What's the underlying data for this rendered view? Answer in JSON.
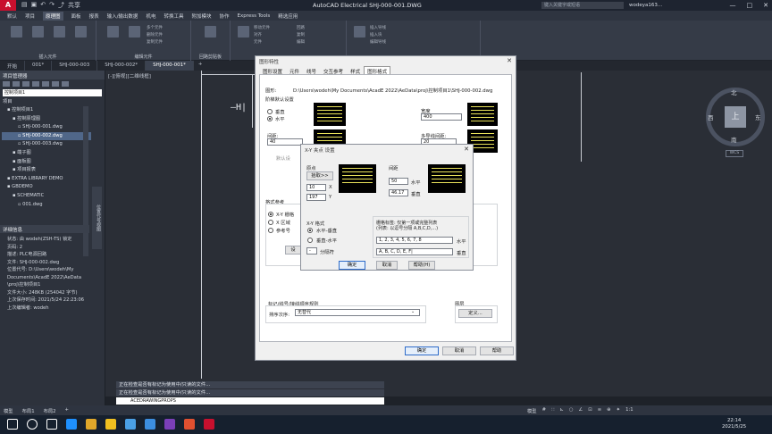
{
  "app": {
    "logo": "A",
    "title": "AutoCAD Electrical    SHJ-000-001.DWG",
    "share": "共享",
    "search_placeholder": "键入关键字或短语",
    "user": "wodeya163...",
    "window_buttons": [
      "—",
      "□",
      "✕"
    ]
  },
  "menu_tabs": [
    "默认",
    "项目",
    "原理图",
    "面板",
    "报表",
    "输入/输出数据",
    "机电",
    "转换工具",
    "附加模块",
    "协作",
    "Express Tools",
    "精选应用"
  ],
  "menu_active_index": 2,
  "ribbon": {
    "groups": [
      "插入元件",
      "编辑元件",
      "回路剪贴板"
    ],
    "small_items": [
      "多个元件",
      "删除元件",
      "复制元件",
      "移动元件",
      "对齐",
      "元件",
      "回路",
      "复制",
      "编辑",
      "插入导线",
      "插入块",
      "编辑导线"
    ]
  },
  "doc_tabs": [
    "开始",
    "001*",
    "SHJ-000-003",
    "SHJ-000-002*",
    "SHJ-000-001*"
  ],
  "doc_tab_active_index": 4,
  "project_manager": {
    "header": "项目管理器",
    "selector": "控制项目1",
    "section": "项目",
    "tree": [
      {
        "label": "控制项目1",
        "level": 1
      },
      {
        "label": "控制原理图",
        "level": 2
      },
      {
        "label": "SHJ-000-001.dwg",
        "level": 3
      },
      {
        "label": "SHJ-000-002.dwg",
        "level": 3
      },
      {
        "label": "SHJ-000-003.dwg",
        "level": 3
      },
      {
        "label": "端子图",
        "level": 2
      },
      {
        "label": "面板图",
        "level": 2
      },
      {
        "label": "项目报表",
        "level": 2
      },
      {
        "label": "EXTRA LIBRARY DEMO",
        "level": 1
      },
      {
        "label": "GBDEMO",
        "level": 1
      },
      {
        "label": "SCHEMATIC",
        "level": 2
      },
      {
        "label": "001.dwg",
        "level": 3
      }
    ],
    "selected_index": 3,
    "side_tab": "位置代号视图",
    "details_header": "详细信息",
    "details": [
      "状态: 由 wodeh(ZSH-TS) 锁定",
      "页码: 2",
      "描述: PLC电源回路",
      "",
      "文件: SHJ-000-002.dwg",
      "",
      "位置代号: D:\\Users\\wodeh\\My",
      "Documents\\AcadE 2022\\AeData",
      "\\proj\\控制项目1",
      "",
      "文件大小: 248KB (254042 字节)",
      "上次保存时间: 2021/5/24 22:23:06",
      "上次编辑者: wodeh"
    ]
  },
  "canvas": {
    "viewport_label": "[-][俯视][二维线框]",
    "cad_text": "—H|"
  },
  "viewcube": {
    "top": "上",
    "north": "北",
    "south": "南",
    "west": "西",
    "east": "东",
    "wcs": "WCS"
  },
  "drawing_props": {
    "title": "图形特性",
    "tabs": [
      "图形设置",
      "元件",
      "线号",
      "交互参考",
      "样式",
      "图形格式"
    ],
    "active_tab": 5,
    "drawing_label": "图形:",
    "drawing_path": "D:\\Users\\wodeh\\My Documents\\AcadE 2022\\AeData\\proj\\控制项目1\\SHJ-000-002.dwg",
    "ladder_section": "阶梯默认设置",
    "vertical": "垂直",
    "horizontal": "水平",
    "width_label": "宽度",
    "width_value": "400",
    "spacing_label": "间距:",
    "spacing_value": "40",
    "multiline_label": "多导线间距:",
    "multiline_value": "20",
    "default_label": "默认设",
    "format_section": "格式参考",
    "fmt_xy": "X-Y 栅格",
    "fmt_x": "X 区域",
    "fmt_ref": "参考号",
    "setup_btn": "设",
    "sort_section": "标记/线号/接线顺序规则",
    "sort_label": "排序次序:",
    "sort_value": "无替代",
    "layer_section": "图层",
    "layer_btn": "定义...",
    "ok": "确定",
    "cancel": "取消",
    "help": "帮助"
  },
  "xy_dialog": {
    "title": "X-Y 夹点 设置",
    "origin_label": "原点",
    "pick_btn": "拾取>>",
    "origin_x": "10",
    "origin_y": "197",
    "x_suffix": "X",
    "y_suffix": "Y",
    "spacing_label": "间距",
    "spacing_h": "50",
    "spacing_v": "46.17",
    "h_suffix": "水平",
    "v_suffix": "垂直",
    "format_label": "X-Y 格式",
    "fmt1": "水平-垂直",
    "fmt2": "垂直-水平",
    "sep_value": "-",
    "sep_label": "分隔符",
    "header_label1": "栅格标签: 仅第一项或完整列表",
    "header_label2": "(列表: 以逗号分隔 A,B,C,D,...)",
    "list_h": "1, 2, 3, 4, 5, 6, 7, 8",
    "list_h_suffix": "水平",
    "list_v": "A, B, C, D, E, F|",
    "list_v_suffix": "垂直",
    "ok": "确定",
    "cancel": "取消",
    "help": "帮助(H)"
  },
  "command": {
    "history": [
      "正在检查是否有标记为使用中/只读的文件...",
      "正在检查是否有标记为使用中/只读的文件..."
    ],
    "input": "ACEDRAWINGPROPS"
  },
  "statusbar": {
    "layout_tabs": [
      "模型",
      "布局1",
      "布局2",
      "+"
    ],
    "model": "模型",
    "scale": "1:1",
    "items": [
      "#",
      "∷",
      "⊾",
      "○",
      "∠",
      "⊡",
      "≡",
      "⊕",
      "✦"
    ]
  },
  "taskbar": {
    "time": "22:14",
    "date": "2021/5/25",
    "colors": [
      "#ffffff",
      "#ffffff",
      "#ffffff",
      "#1e90ff",
      "#e0a72a",
      "#f0c020",
      "#4aa0e6",
      "#3c8ee0",
      "#7b3fb8",
      "#e05030",
      "#c8102e"
    ]
  }
}
